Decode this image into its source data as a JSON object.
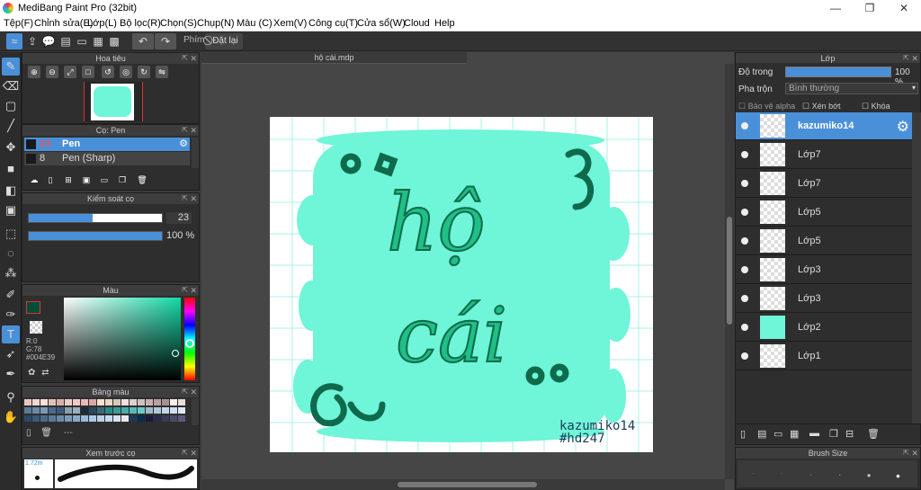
{
  "window": {
    "title": "MediBang Paint Pro (32bit)"
  },
  "menu": [
    "Tệp(F)",
    "Chỉnh sửa(E)",
    "Lớp(L)",
    "Bộ lọc(R)",
    "Chọn(S)",
    "Chụp(N)",
    "Màu (C)",
    "Xem(V)",
    "Công cụ(T)",
    "Cửa sổ(W)",
    "Cloud",
    "Help"
  ],
  "toolbar": {
    "phim_label": "Phím",
    "reset_label": "Đặt lại"
  },
  "document": {
    "tab": "hộ cái.mdp",
    "artist_line1": "kazumiko14",
    "artist_line2": "#hd247",
    "art_text1": "hộ",
    "art_text2": "cái"
  },
  "navigator": {
    "title": "Hoa tiêu"
  },
  "brush_panel": {
    "title": "Cọ: Pen",
    "items": [
      {
        "size": "23",
        "name": "Pen"
      },
      {
        "size": "8",
        "name": "Pen (Sharp)"
      }
    ]
  },
  "brush_control": {
    "title": "Kiểm soát cọ",
    "size_value": "23",
    "opacity_value": "100 %",
    "size_fraction": 0.48,
    "opacity_fraction": 1.0
  },
  "color_panel": {
    "title": "Màu",
    "r": "R:0",
    "g": "G:78",
    "hex": "#004E39",
    "current_color": "#004E39"
  },
  "palette": {
    "title": "Bảng màu",
    "extra": "---"
  },
  "brush_preview": {
    "title": "Xem trước cọ",
    "size": "1.72m"
  },
  "layers_panel": {
    "title": "Lớp",
    "opacity_label": "Độ trong",
    "opacity_value": "100 %",
    "blend_label": "Pha trộn",
    "blend_value": "Bình thường",
    "protect_alpha": "Bảo vệ alpha",
    "clipping": "Xén bớt",
    "lock": "Khóa",
    "layers": [
      {
        "name": "kazumiko14",
        "selected": true
      },
      {
        "name": "Lớp7"
      },
      {
        "name": "Lớp7"
      },
      {
        "name": "Lớp5"
      },
      {
        "name": "Lớp5"
      },
      {
        "name": "Lớp3"
      },
      {
        "name": "Lớp3"
      },
      {
        "name": "Lớp2"
      },
      {
        "name": "Lớp1"
      }
    ]
  },
  "brush_size_panel": {
    "title": "Brush Size"
  },
  "colors": {
    "accent": "#4a90d9",
    "mint": "#6ff5d8",
    "ink": "#1a9c6a"
  }
}
